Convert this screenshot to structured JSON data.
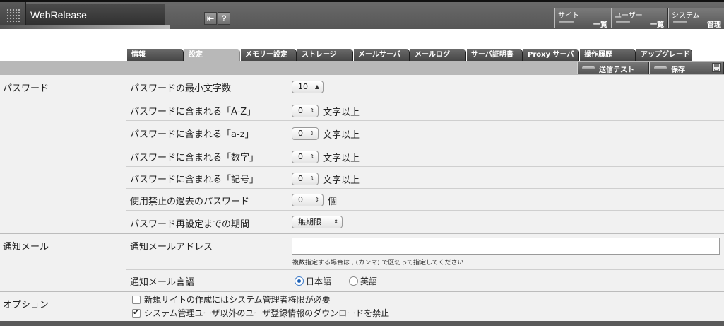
{
  "app": {
    "title": "WebRelease"
  },
  "header": {
    "icons": [
      "logout-icon",
      "help-icon"
    ],
    "help_glyph": "?",
    "logout_glyph": "⇤",
    "buttons": [
      {
        "top": "サイト",
        "bottom": "一覧"
      },
      {
        "top": "ユーザー",
        "bottom": "一覧"
      },
      {
        "top": "システム",
        "bottom": "管理"
      }
    ]
  },
  "tabs": [
    {
      "label": "情報"
    },
    {
      "label": "設定"
    },
    {
      "label": "メモリー設定"
    },
    {
      "label": "ストレージ"
    },
    {
      "label": "メールサーバ"
    },
    {
      "label": "メールログ"
    },
    {
      "label": "サーバ証明書"
    },
    {
      "label": "Proxy サーバ"
    },
    {
      "label": "操作履歴"
    },
    {
      "label": "アップグレード"
    }
  ],
  "toolbar": {
    "send_test_label": "送信テスト",
    "save_label": "保存"
  },
  "sections": {
    "password": {
      "label": "パスワード",
      "rows": [
        {
          "label": "パスワードの最小文字数",
          "value": "10",
          "unit": ""
        },
        {
          "label": "パスワードに含まれる「A-Z」",
          "value": "0",
          "unit": "文字以上"
        },
        {
          "label": "パスワードに含まれる「a-z」",
          "value": "0",
          "unit": "文字以上"
        },
        {
          "label": "パスワードに含まれる「数字」",
          "value": "0",
          "unit": "文字以上"
        },
        {
          "label": "パスワードに含まれる「記号」",
          "value": "0",
          "unit": "文字以上"
        },
        {
          "label": "使用禁止の過去のパスワード",
          "value": "0",
          "unit": "個"
        },
        {
          "label": "パスワード再設定までの期間",
          "value": "無期限",
          "unit": ""
        }
      ]
    },
    "mail": {
      "label": "通知メール",
      "address_label": "通知メールアドレス",
      "address_value": "",
      "address_hint": "複数指定する場合は , (カンマ) で区切って指定してください",
      "language_label": "通知メール言語",
      "language_options": [
        "日本語",
        "英語"
      ],
      "language_selected": "日本語"
    },
    "options": {
      "label": "オプション",
      "items": [
        {
          "label": "新規サイトの作成にはシステム管理者権限が必要",
          "checked": false
        },
        {
          "label": "システム管理ユーザ以外のユーザ登録情報のダウンロードを禁止",
          "checked": true
        }
      ]
    }
  },
  "colors": {
    "header": "#606060",
    "tab": "#555555",
    "tab_active": "#b8b8b8",
    "form_bg": "#f1f1f1",
    "radio_accent": "#1a5fb4"
  }
}
